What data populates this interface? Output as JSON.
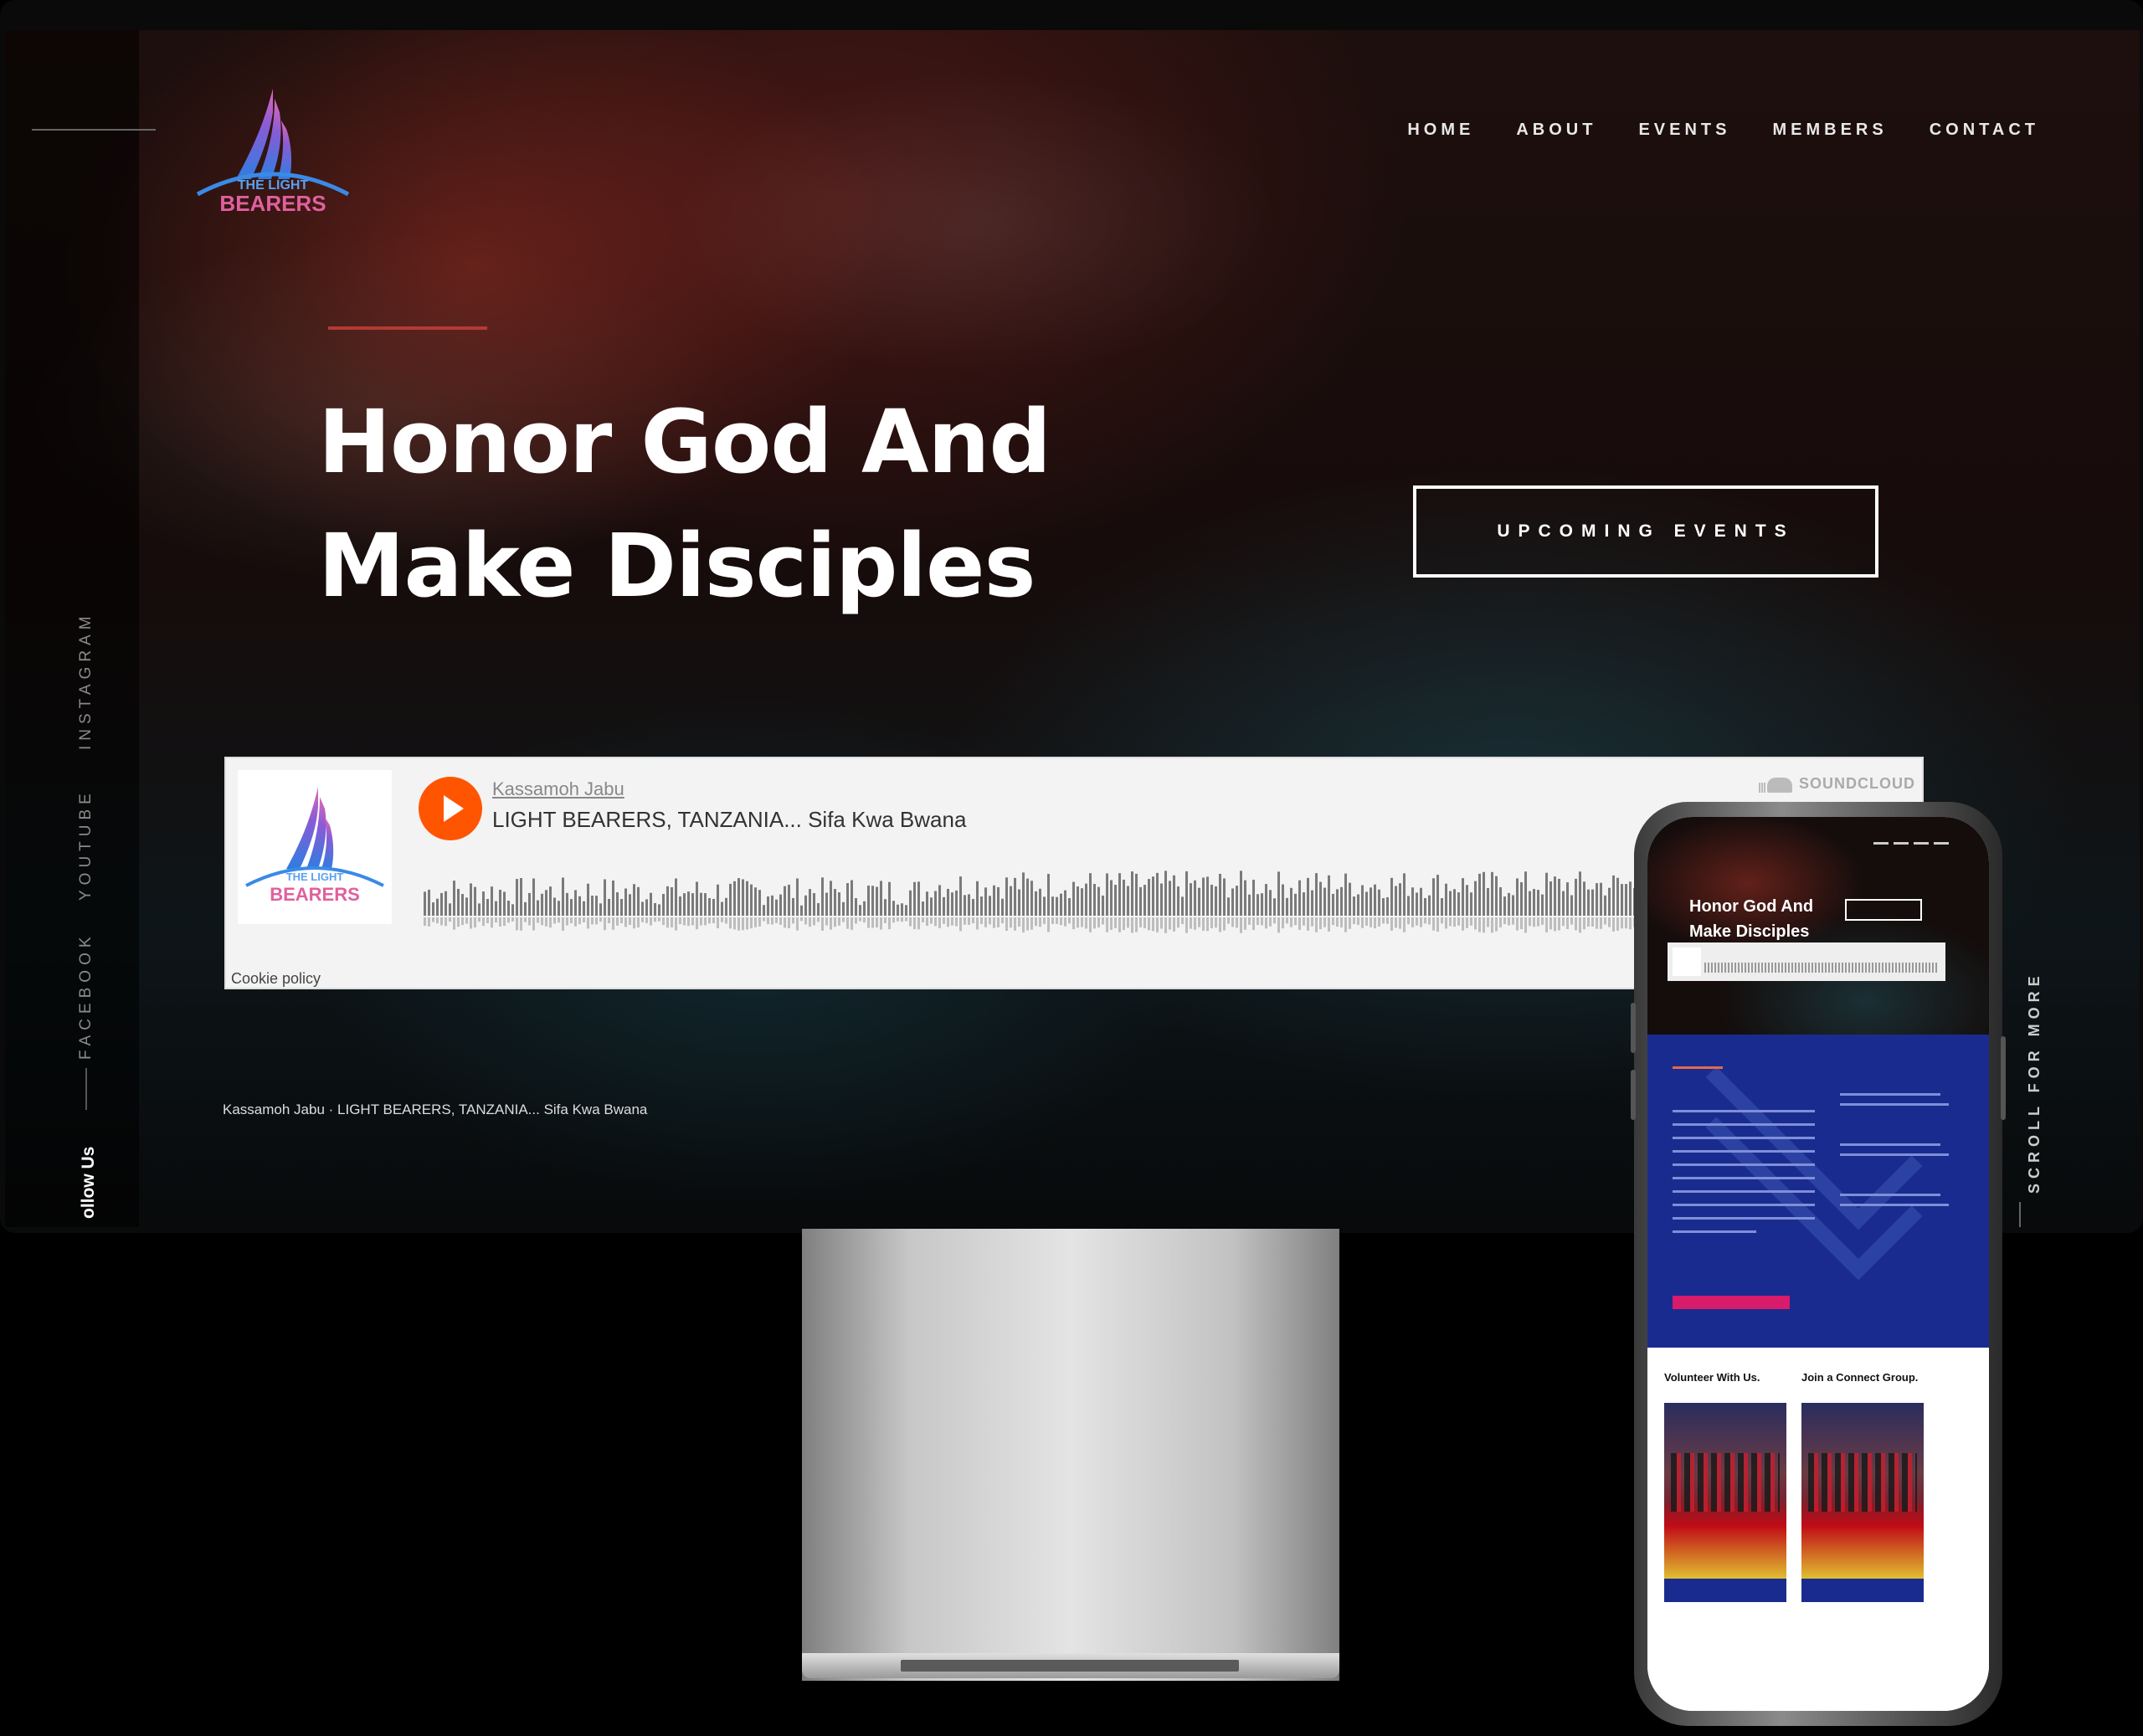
{
  "site": {
    "logo": {
      "line1": "THE LIGHT",
      "line2": "BEARERS"
    },
    "nav": [
      "HOME",
      "ABOUT",
      "EVENTS",
      "MEMBERS",
      "CONTACT"
    ],
    "social": [
      "INSTAGRAM",
      "YOUTUBE",
      "FACEBOOK"
    ],
    "follow": "ollow Us",
    "hero": {
      "line1": "Honor God And",
      "line2": "Make Disciples"
    },
    "cta": "UPCOMING EVENTS",
    "scroll": "SCROLL FOR MORE"
  },
  "soundcloud": {
    "user": "Kassamoh Jabu",
    "track": "LIGHT BEARERS, TANZANIA... Sifa Kwa Bwana",
    "brand": "SOUNDCLOUD",
    "cookie": "Cookie policy"
  },
  "caption": "Kassamoh Jabu · LIGHT BEARERS, TANZANIA... Sifa Kwa Bwana",
  "phone": {
    "hero": {
      "line1": "Honor God And",
      "line2": "Make Disciples"
    },
    "cards": [
      "Volunteer With Us.",
      "Join a Connect Group."
    ]
  },
  "colors": {
    "accent": "#b33a34",
    "play": "#ff5500",
    "blue": "#1a2b8f",
    "pink": "#d81b6b"
  }
}
